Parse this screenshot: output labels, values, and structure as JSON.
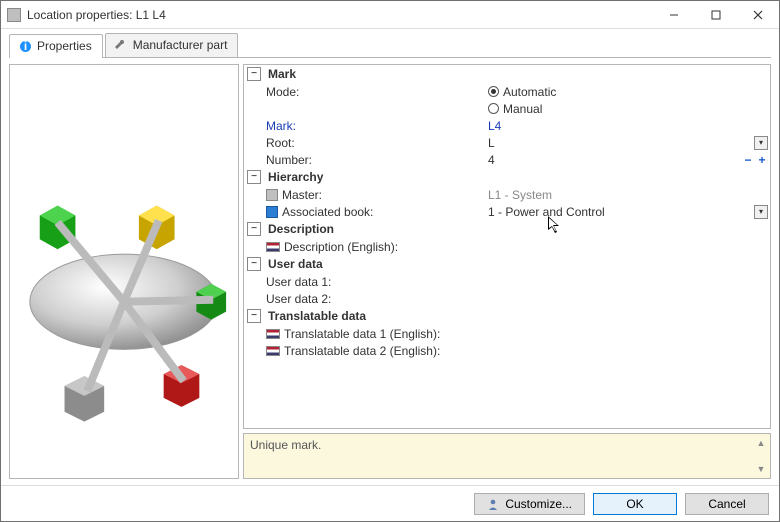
{
  "window": {
    "title": "Location properties: L1 L4"
  },
  "tabs": {
    "properties": "Properties",
    "manufacturer": "Manufacturer part"
  },
  "sections": {
    "mark": "Mark",
    "hierarchy": "Hierarchy",
    "description": "Description",
    "userdata": "User data",
    "translatable": "Translatable data"
  },
  "labels": {
    "mode": "Mode:",
    "mark": "Mark:",
    "root": "Root:",
    "number": "Number:",
    "master": "Master:",
    "assoc_book": "Associated book:",
    "desc_en": "Description (English):",
    "ud1": "User data 1:",
    "ud2": "User data 2:",
    "td1": "Translatable data 1 (English):",
    "td2": "Translatable data 2 (English):"
  },
  "values": {
    "mode_auto": "Automatic",
    "mode_manual": "Manual",
    "mark": "L4",
    "root": "L",
    "number": "4",
    "master": "L1 - System",
    "assoc_book": "1 - Power and Control"
  },
  "hint": "Unique mark.",
  "buttons": {
    "customize": "Customize...",
    "ok": "OK",
    "cancel": "Cancel"
  }
}
